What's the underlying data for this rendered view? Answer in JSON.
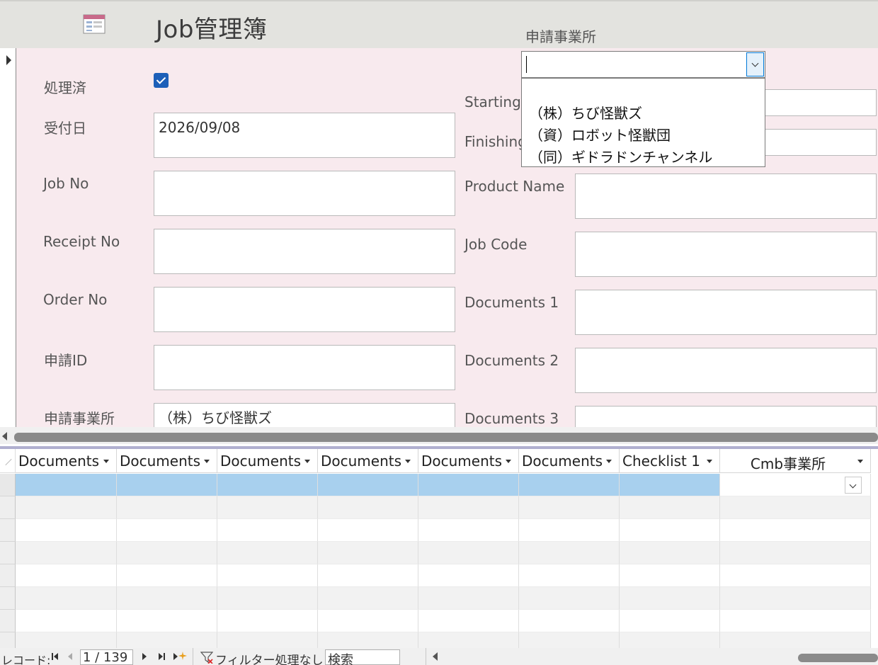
{
  "header": {
    "title": "Job管理簿",
    "combo_label": "申請事業所",
    "icon": "form-icon"
  },
  "form": {
    "left": [
      {
        "label": "処理済",
        "type": "checkbox",
        "checked": true
      },
      {
        "label": "受付日",
        "value": "2026/09/08"
      },
      {
        "label": "Job No",
        "value": ""
      },
      {
        "label": "Receipt No",
        "value": ""
      },
      {
        "label": "Order No",
        "value": ""
      },
      {
        "label": "申請ID",
        "value": ""
      },
      {
        "label": "申請事業所",
        "value": "（株）ちび怪獣ズ"
      }
    ],
    "right": [
      {
        "label": "Starting",
        "value": ""
      },
      {
        "label": "Finishing",
        "value": ""
      },
      {
        "label": "Product Name",
        "value": ""
      },
      {
        "label": "Job Code",
        "value": ""
      },
      {
        "label": "Documents 1",
        "value": ""
      },
      {
        "label": "Documents 2",
        "value": ""
      },
      {
        "label": "Documents 3",
        "value": ""
      }
    ]
  },
  "combo": {
    "value": "",
    "options": [
      "（株）ちび怪獣ズ",
      "（資）ロボット怪獣団",
      "（同）ギドラドンチャンネル"
    ]
  },
  "datasheet": {
    "columns": [
      "Documents",
      "Documents",
      "Documents",
      "Documents",
      "Documents",
      "Documents",
      "Checklist 1",
      "Cmb事業所"
    ]
  },
  "navbar": {
    "label": "レコード:",
    "record": "1 / 139",
    "filter": "フィルター処理なし",
    "search": "検索"
  },
  "colors": {
    "header_bg": "#e3e3df",
    "detail_bg": "#f8eaee",
    "checkbox": "#1d5fb8",
    "row_highlight": "#a8d0ee",
    "splitter": "#b0afcf"
  }
}
